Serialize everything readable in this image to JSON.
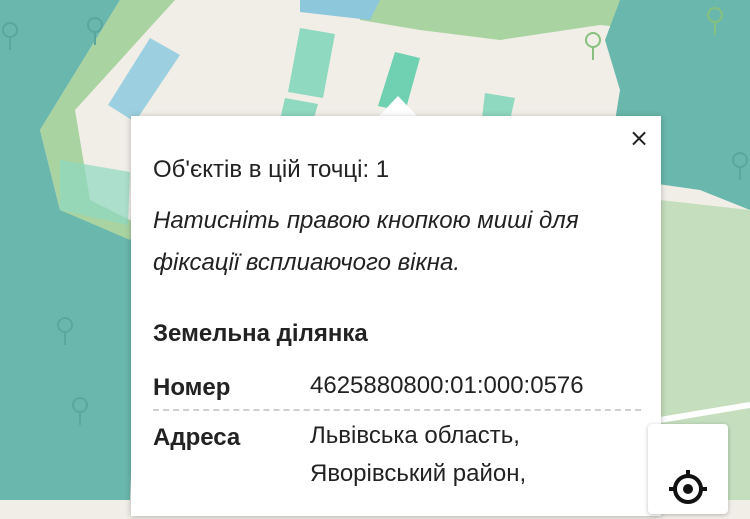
{
  "popup": {
    "close_glyph": "×",
    "count_line": "Об'єктів в цій точці: 1",
    "hint": "Натисніть правою кнопкою миші для фіксації всплиаючого вікна.",
    "section_title": "Земельна ділянка",
    "rows": [
      {
        "label": "Номер",
        "value": "4625880800:01:000:0576"
      },
      {
        "label": "Адреса",
        "value_lines": [
          "Львівська область,",
          "Яворівський район,"
        ]
      }
    ]
  },
  "icons": {
    "map_tree": "tree-icon",
    "locate": "locate-icon"
  },
  "colors": {
    "water": "#6ab7ad",
    "forest": "#a9d3a1",
    "land": "#f1eee8",
    "building_blue": "#9ccfe0",
    "building_green": "#8fd9c0",
    "building_teal": "#6fd1b2"
  }
}
